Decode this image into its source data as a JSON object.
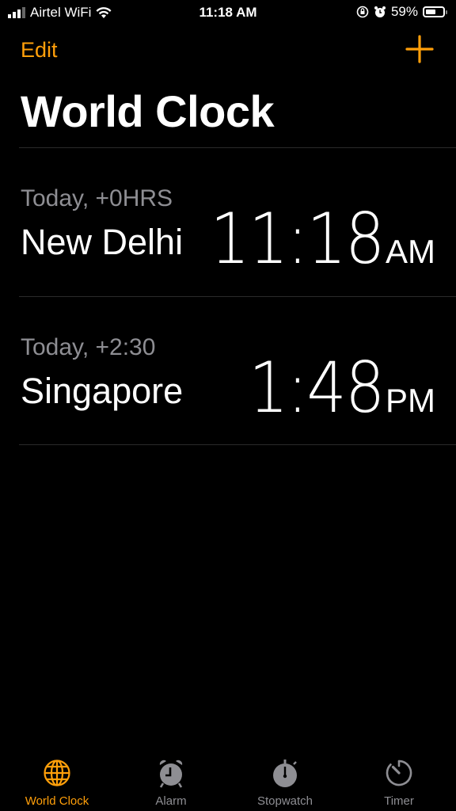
{
  "status_bar": {
    "carrier": "Airtel WiFi",
    "time": "11:18 AM",
    "battery": "59%",
    "battery_level": 0.59
  },
  "nav": {
    "edit_label": "Edit",
    "add_icon": "plus-icon"
  },
  "title": "World Clock",
  "accent_color": "#ff9f0a",
  "clocks": [
    {
      "offset": "Today, +0HRS",
      "city": "New Delhi",
      "time": "11:18",
      "ampm": "AM"
    },
    {
      "offset": "Today, +2:30",
      "city": "Singapore",
      "time": "1:48",
      "ampm": "PM"
    }
  ],
  "tabs": [
    {
      "label": "World Clock",
      "icon": "globe-icon",
      "active": true
    },
    {
      "label": "Alarm",
      "icon": "alarm-clock-icon",
      "active": false
    },
    {
      "label": "Stopwatch",
      "icon": "stopwatch-icon",
      "active": false
    },
    {
      "label": "Timer",
      "icon": "timer-icon",
      "active": false
    }
  ]
}
